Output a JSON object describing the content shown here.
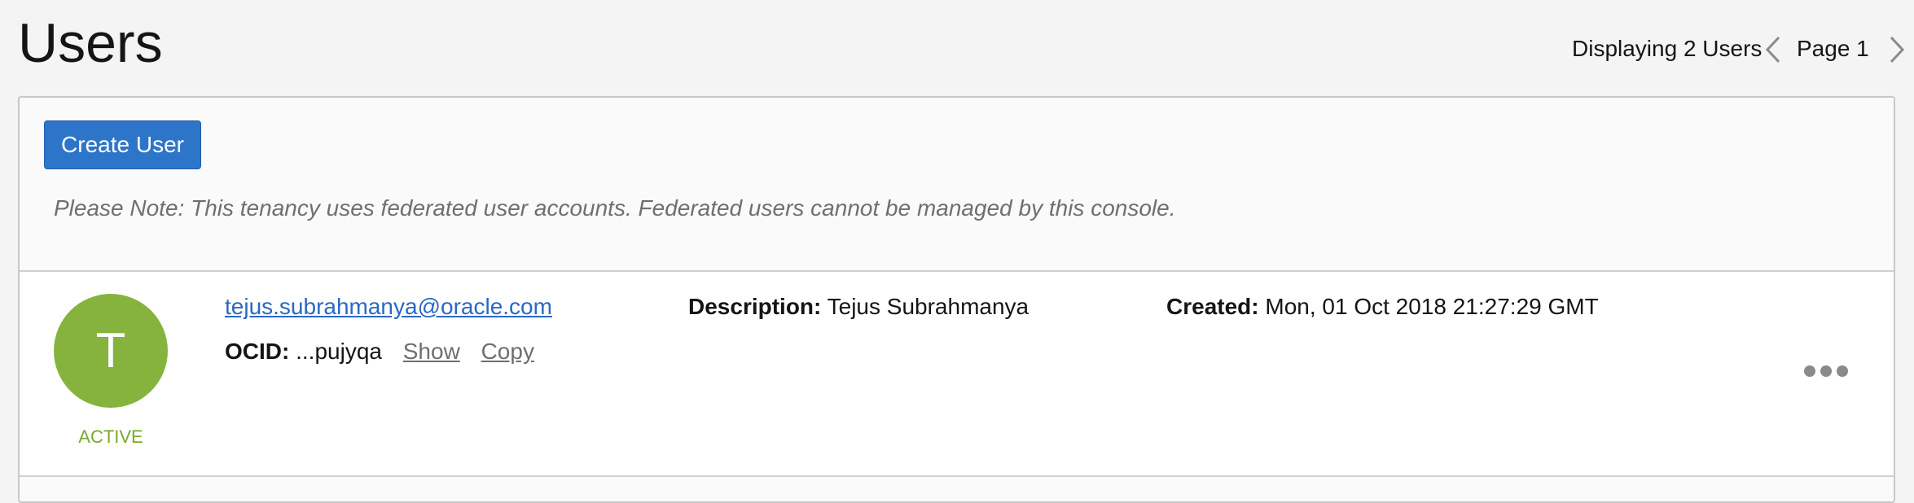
{
  "header": {
    "title": "Users",
    "pager": {
      "count_label": "Displaying 2 Users",
      "page_label": "Page 1",
      "prev_icon": "chevron-left-icon",
      "next_icon": "chevron-right-icon"
    }
  },
  "toolbar": {
    "create_label": "Create User",
    "note": "Please Note: This tenancy uses federated user accounts. Federated users cannot be managed by this console."
  },
  "users": [
    {
      "initial": "T",
      "status": "ACTIVE",
      "email": "tejus.subrahmanya@oracle.com",
      "ocid_label": "OCID:",
      "ocid_value": "...pujyqa",
      "show_label": "Show",
      "copy_label": "Copy",
      "description_label": "Description:",
      "description": "Tejus Subrahmanya",
      "created_label": "Created:",
      "created": "Mon, 01 Oct 2018 21:27:29 GMT",
      "actions_icon": "more-actions-icon"
    }
  ],
  "colors": {
    "accent": "#2d75c9",
    "avatar": "#86b33e",
    "status_active": "#77aa2b",
    "link": "#2a68c4"
  }
}
